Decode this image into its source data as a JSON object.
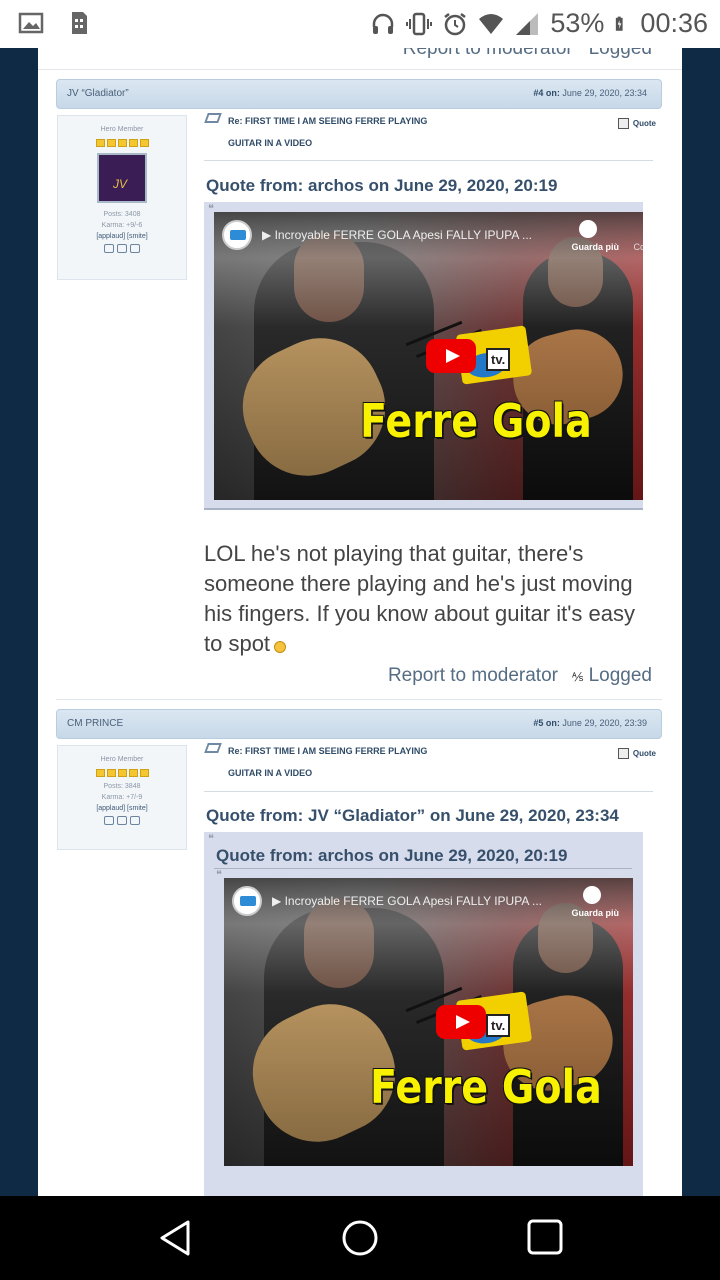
{
  "status_bar": {
    "battery": "53%",
    "time": "00:36",
    "icons": [
      "gallery-icon",
      "sim-icon",
      "headset-icon",
      "vibrate-icon",
      "alarm-icon",
      "wifi-icon",
      "signal-icon",
      "battery-icon"
    ]
  },
  "top": {
    "report": "Report to moderator",
    "logged": "Logged"
  },
  "posts": [
    {
      "author": "JV “Gladiator”",
      "number": "#4",
      "on_label": "on:",
      "date": "June 29, 2020, 23:34",
      "rank": "Hero Member",
      "posts": "Posts: 3408",
      "karma": "Karma: +9/-6",
      "karma_links": "[applaud] [smite]",
      "subject_line1": "Re: FIRST TIME I AM SEEING FERRE PLAYING",
      "subject_line2": "GUITAR IN A VIDEO",
      "quote_button": "Quote",
      "quote_from": "Quote from: archos on June 29, 2020, 20:19",
      "video_title": "Incroyable FERRE GOLA Apesi FALLY IPUPA ...",
      "video_watch_later": "Guarda più",
      "video_share": "Co",
      "video_tv": "tv.",
      "video_brand": "Ferre Gola",
      "body": "LOL he's not playing that guitar, there's someone there playing and he's just moving his fingers. If you know about guitar it's easy to spot",
      "report": "Report to moderator",
      "logged": "Logged"
    },
    {
      "author": "CM PRINCE",
      "number": "#5",
      "on_label": "on:",
      "date": "June 29, 2020, 23:39",
      "rank": "Hero Member",
      "posts": "Posts: 3848",
      "karma": "Karma: +7/-9",
      "karma_links": "[applaud] [smite]",
      "subject_line1": "Re: FIRST TIME I AM SEEING FERRE PLAYING",
      "subject_line2": "GUITAR IN A VIDEO",
      "quote_button": "Quote",
      "quote_from": "Quote from: JV “Gladiator” on June 29, 2020, 23:34",
      "inner_quote_from": "Quote from: archos on June 29, 2020, 20:19",
      "video_title": "Incroyable FERRE GOLA Apesi FALLY IPUPA ...",
      "video_watch_later": "Guarda più",
      "video_tv": "tv.",
      "video_brand": "Ferre Gola"
    }
  ],
  "nav": [
    "back-icon",
    "home-icon",
    "recents-icon"
  ]
}
